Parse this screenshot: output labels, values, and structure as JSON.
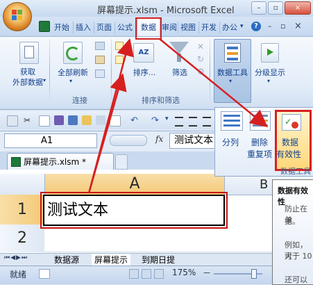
{
  "window": {
    "title": "屏幕提示.xlsm - Microsoft Excel",
    "minimize": "–",
    "restore": "▫",
    "close": "×"
  },
  "tabs": [
    "开始",
    "插入",
    "页面",
    "公式",
    "数据",
    "审阅",
    "视图",
    "开发",
    "办公"
  ],
  "ribbon": {
    "get_external": "获取\n外部数据",
    "refresh_all": "全部刷新",
    "group_connections": "连接",
    "sort_az": "AZ",
    "sort": "排序...",
    "filter": "筛选",
    "group_sort_filter": "排序和筛选",
    "data_tools": "数据工具",
    "outline": "分级显示"
  },
  "dropdown": {
    "text_to_columns": "分列",
    "remove_duplicates_1": "删除",
    "remove_duplicates_2": "重复项",
    "validation_1": "数据",
    "validation_2": "有效性",
    "group_label": "数据工具"
  },
  "formula_bar": {
    "name_box": "A1",
    "fx": "fx",
    "formula": "测试文本"
  },
  "doc_tab": {
    "label": "屏幕提示.xlsm *"
  },
  "grid": {
    "col_a": "A",
    "col_b": "B",
    "row_1": "1",
    "row_2": "2",
    "a1": "测试文本"
  },
  "sheets": [
    "数据源",
    "屏幕提示",
    "到期日提"
  ],
  "status": {
    "ready": "就绪",
    "zoom": "175%",
    "zoom_minus": "－",
    "zoom_plus": "＋"
  },
  "tooltip": {
    "title": "数据有效性",
    "line1": "防止在单",
    "line2": "据。",
    "line3": "例如，可",
    "line4": "大于 10",
    "line5": "还可以"
  },
  "colors": {
    "highlight_red": "#d62020",
    "ribbon_text": "#15428b",
    "selected_header": "#f4c978"
  }
}
